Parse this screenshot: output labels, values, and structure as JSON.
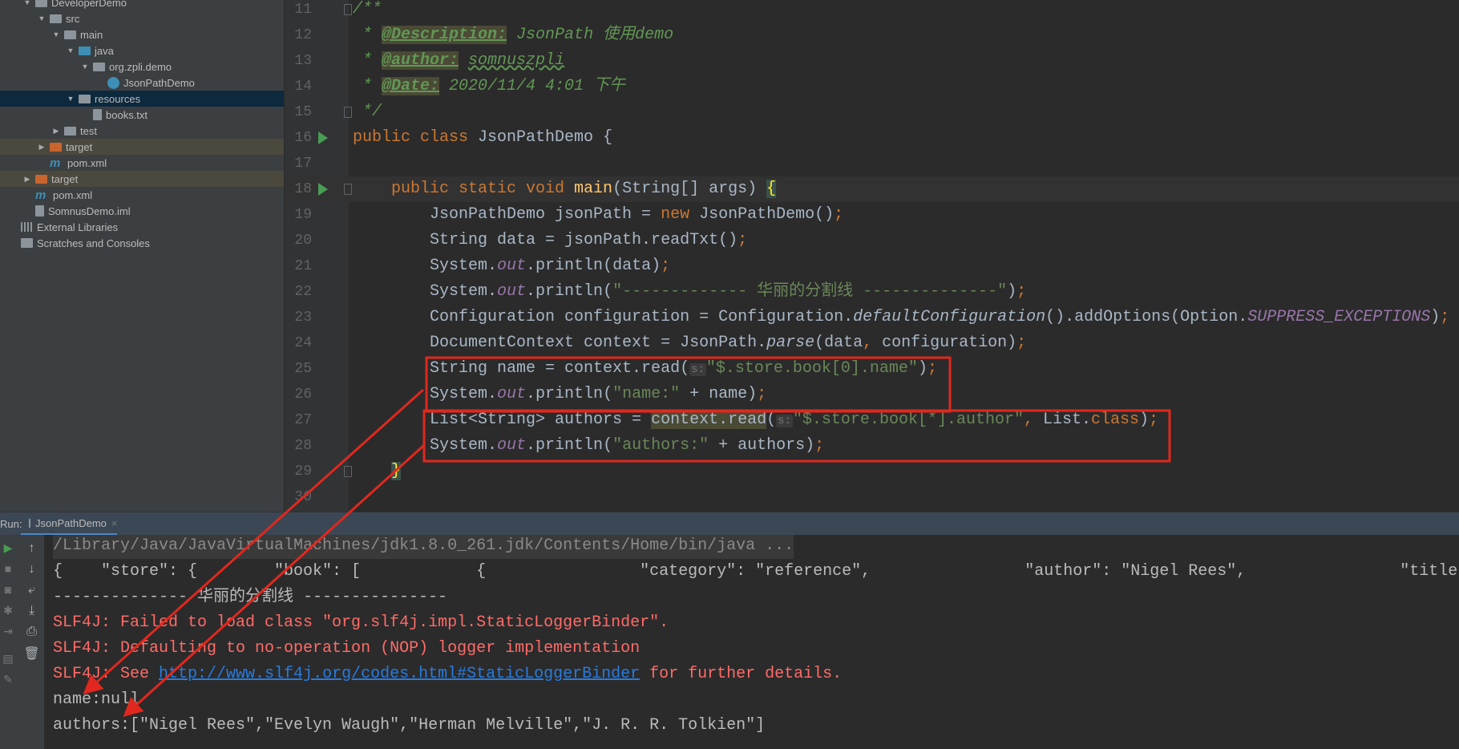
{
  "project_tree": [
    {
      "label": "DeveloperDemo",
      "depth": 0,
      "toggle": "open",
      "icon": "module"
    },
    {
      "label": "src",
      "depth": 1,
      "toggle": "open",
      "icon": "folder"
    },
    {
      "label": "main",
      "depth": 2,
      "toggle": "open",
      "icon": "folder"
    },
    {
      "label": "java",
      "depth": 3,
      "toggle": "open",
      "icon": "source-folder"
    },
    {
      "label": "org.zpli.demo",
      "depth": 4,
      "toggle": "open",
      "icon": "package"
    },
    {
      "label": "JsonPathDemo",
      "depth": 5,
      "toggle": "none",
      "icon": "class"
    },
    {
      "label": "resources",
      "depth": 3,
      "toggle": "open",
      "icon": "resources-folder",
      "selected": true
    },
    {
      "label": "books.txt",
      "depth": 4,
      "toggle": "none",
      "icon": "text-file"
    },
    {
      "label": "test",
      "depth": 2,
      "toggle": "closed",
      "icon": "folder"
    },
    {
      "label": "target",
      "depth": 1,
      "toggle": "closed",
      "icon": "excluded-folder",
      "excluded": true
    },
    {
      "label": "pom.xml",
      "depth": 1,
      "toggle": "none",
      "icon": "maven"
    },
    {
      "label": "target",
      "depth": 0,
      "toggle": "closed",
      "icon": "excluded-folder",
      "excluded": true
    },
    {
      "label": "pom.xml",
      "depth": 0,
      "toggle": "none",
      "icon": "maven"
    },
    {
      "label": "SomnusDemo.iml",
      "depth": 0,
      "toggle": "none",
      "icon": "iml-file"
    },
    {
      "label": "External Libraries",
      "depth": -1,
      "toggle": "none",
      "icon": "libraries"
    },
    {
      "label": "Scratches and Consoles",
      "depth": -1,
      "toggle": "none",
      "icon": "scratches"
    }
  ],
  "editor": {
    "lines": [
      {
        "n": "11",
        "fold": true,
        "tokens": [
          [
            "/**",
            "doc"
          ]
        ]
      },
      {
        "n": "12",
        "tokens": [
          [
            " * ",
            "doc"
          ],
          [
            "@Description:",
            "tag"
          ],
          [
            " JsonPath 使用demo",
            "doc"
          ]
        ]
      },
      {
        "n": "13",
        "tokens": [
          [
            " * ",
            "doc"
          ],
          [
            "@author:",
            "tag"
          ],
          [
            " ",
            "doc"
          ],
          [
            "somnuszpli",
            "docval"
          ]
        ]
      },
      {
        "n": "14",
        "tokens": [
          [
            " * ",
            "doc"
          ],
          [
            "@Date:",
            "tag"
          ],
          [
            " 2020/11/4 4:01 下午",
            "doc"
          ]
        ]
      },
      {
        "n": "15",
        "fold": true,
        "tokens": [
          [
            " */",
            "doc"
          ]
        ]
      },
      {
        "n": "16",
        "run": true,
        "tokens": [
          [
            "public class ",
            "kw"
          ],
          [
            "JsonPathDemo {",
            ""
          ]
        ]
      },
      {
        "n": "17",
        "tokens": []
      },
      {
        "n": "18",
        "run": true,
        "fold": true,
        "current": true,
        "tokens": [
          [
            "    public static void ",
            "kw"
          ],
          [
            "main",
            "fn"
          ],
          [
            "(String[] args) ",
            ""
          ],
          [
            "{",
            "brace"
          ]
        ]
      },
      {
        "n": "19",
        "tokens": [
          [
            "        JsonPathDemo jsonPath = ",
            ""
          ],
          [
            "new ",
            "kw"
          ],
          [
            "JsonPathDemo()",
            ""
          ],
          [
            ";",
            "kw"
          ]
        ]
      },
      {
        "n": "20",
        "tokens": [
          [
            "        String data = jsonPath.readTxt()",
            ""
          ],
          [
            ";",
            "kw"
          ]
        ]
      },
      {
        "n": "21",
        "tokens": [
          [
            "        System.",
            ""
          ],
          [
            "out",
            "field"
          ],
          [
            ".println(data)",
            ""
          ],
          [
            ";",
            "kw"
          ]
        ]
      },
      {
        "n": "22",
        "tokens": [
          [
            "        System.",
            ""
          ],
          [
            "out",
            "field"
          ],
          [
            ".println(",
            ""
          ],
          [
            "\"------------- 华丽的分割线 --------------\"",
            "str"
          ],
          [
            ")",
            ""
          ],
          [
            ";",
            "kw"
          ]
        ]
      },
      {
        "n": "23",
        "tokens": [
          [
            "        Configuration configuration = Configuration.",
            ""
          ],
          [
            "defaultConfiguration",
            "sm"
          ],
          [
            "().addOptions(Option.",
            ""
          ],
          [
            "SUPPRESS_EXCEPTIONS",
            "field"
          ],
          [
            ")",
            ""
          ],
          [
            ";",
            "kw"
          ]
        ]
      },
      {
        "n": "24",
        "tokens": [
          [
            "        DocumentContext context = JsonPath.",
            ""
          ],
          [
            "parse",
            "sm"
          ],
          [
            "(data",
            ""
          ],
          [
            ", ",
            "kw"
          ],
          [
            "configuration)",
            ""
          ],
          [
            ";",
            "kw"
          ]
        ]
      },
      {
        "n": "25",
        "tokens": [
          [
            "        String name = context.read(",
            ""
          ],
          [
            "s:",
            "hint"
          ],
          [
            "\"$.store.book[0].name\"",
            "str"
          ],
          [
            ")",
            ""
          ],
          [
            ";",
            "kw"
          ]
        ]
      },
      {
        "n": "26",
        "tokens": [
          [
            "        System.",
            ""
          ],
          [
            "out",
            "field"
          ],
          [
            ".println(",
            ""
          ],
          [
            "\"name:\"",
            "str"
          ],
          [
            " + name)",
            ""
          ],
          [
            ";",
            "kw"
          ]
        ]
      },
      {
        "n": "27",
        "tokens": [
          [
            "        List<String> authors = ",
            ""
          ],
          [
            "context.read",
            "hl"
          ],
          [
            "(",
            ""
          ],
          [
            "s:",
            "hint"
          ],
          [
            "\"$.store.book[*].author\"",
            "str"
          ],
          [
            ", ",
            "kw"
          ],
          [
            "List.",
            ""
          ],
          [
            "class",
            "kw"
          ],
          [
            ")",
            ""
          ],
          [
            ";",
            "kw"
          ]
        ]
      },
      {
        "n": "28",
        "tokens": [
          [
            "        System.",
            ""
          ],
          [
            "out",
            "field"
          ],
          [
            ".println(",
            ""
          ],
          [
            "\"authors:\"",
            "str"
          ],
          [
            " + authors)",
            ""
          ],
          [
            ";",
            "kw"
          ]
        ]
      },
      {
        "n": "29",
        "fold": true,
        "tokens": [
          [
            "    ",
            ""
          ],
          [
            "}",
            "brace"
          ]
        ]
      },
      {
        "n": "30",
        "tokens": []
      }
    ]
  },
  "run_panel": {
    "label": "Run:",
    "tab": "JsonPathDemo",
    "close": "×",
    "lines": [
      {
        "type": "cmd",
        "tokens": [
          [
            "/Library/Java/JavaVirtualMachines/jdk1.8.0_261.jdk/Contents/Home/bin/java ...",
            ""
          ]
        ]
      },
      {
        "tokens": [
          [
            "{    \"store\": {        \"book\": [            {                \"category\": \"reference\",                \"author\": \"Nigel Rees\",                \"title\"",
            ""
          ]
        ]
      },
      {
        "tokens": [
          [
            "-------------- 华丽的分割线 ---------------",
            ""
          ]
        ]
      },
      {
        "tokens": [
          [
            "SLF4J: Failed to load class \"org.slf4j.impl.StaticLoggerBinder\".",
            "err"
          ]
        ]
      },
      {
        "tokens": [
          [
            "SLF4J: Defaulting to no-operation (NOP) logger implementation",
            "err"
          ]
        ]
      },
      {
        "tokens": [
          [
            "SLF4J: See ",
            "err"
          ],
          [
            "http://www.slf4j.org/codes.html#StaticLoggerBinder",
            "link"
          ],
          [
            " for further details.",
            "err"
          ]
        ]
      },
      {
        "tokens": [
          [
            "name:null",
            ""
          ]
        ]
      },
      {
        "tokens": [
          [
            "authors:[\"Nigel Rees\",\"Evelyn Waugh\",\"Herman Melville\",\"J. R. R. Tolkien\"]",
            ""
          ]
        ]
      }
    ],
    "tools_left": [
      "run-icon",
      "stop-icon",
      "camera-icon",
      "debug-icon",
      "exit-icon",
      "layout-icon",
      "pin-icon"
    ],
    "tools": [
      "arrow-up-icon",
      "arrow-down-icon",
      "soft-wrap-icon",
      "scroll-to-end-icon",
      "print-icon",
      "trash-icon"
    ]
  },
  "annotation_color": "#e0281e",
  "colors": {
    "keyword": "#cc7832",
    "string": "#6a8759",
    "doc": "#629755",
    "field": "#9876aa",
    "method": "#ffc66d",
    "error": "#ff6b68",
    "link": "#287bde"
  }
}
